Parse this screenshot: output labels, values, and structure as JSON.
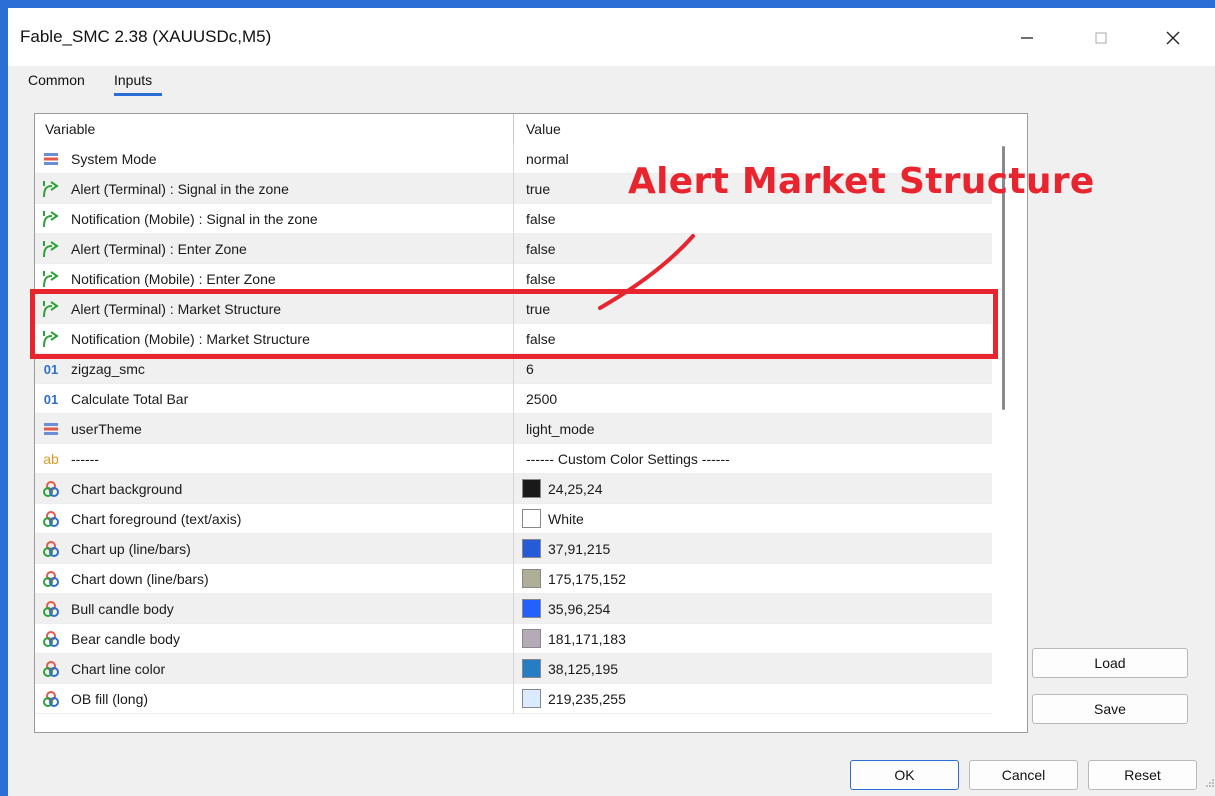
{
  "window": {
    "title": "Fable_SMC 2.38 (XAUUSDc,M5)",
    "accent_color": "#2b6fd6",
    "controls": [
      "minimize-icon",
      "maximize-icon",
      "close-icon"
    ]
  },
  "tabs": [
    {
      "label": "Common",
      "active": false
    },
    {
      "label": "Inputs",
      "active": true
    }
  ],
  "table": {
    "headers": {
      "variable": "Variable",
      "value": "Value"
    },
    "rows": [
      {
        "icon": "enum-icon",
        "variable": "System Mode",
        "value": "normal"
      },
      {
        "icon": "bool-icon",
        "variable": "Alert (Terminal) : Signal in the zone",
        "value": "true"
      },
      {
        "icon": "bool-icon",
        "variable": "Notification (Mobile) : Signal in the zone",
        "value": "false"
      },
      {
        "icon": "bool-icon",
        "variable": "Alert (Terminal) : Enter Zone",
        "value": "false"
      },
      {
        "icon": "bool-icon",
        "variable": "Notification (Mobile) : Enter Zone",
        "value": "false"
      },
      {
        "icon": "bool-icon",
        "variable": "Alert (Terminal) : Market Structure",
        "value": "true"
      },
      {
        "icon": "bool-icon",
        "variable": "Notification (Mobile) : Market Structure",
        "value": "false"
      },
      {
        "icon": "int-icon",
        "variable": "zigzag_smc",
        "value": "6"
      },
      {
        "icon": "int-icon",
        "variable": "Calculate Total Bar",
        "value": "2500"
      },
      {
        "icon": "enum-icon",
        "variable": "userTheme",
        "value": "light_mode"
      },
      {
        "icon": "string-icon",
        "variable": "------",
        "value": "------ Custom Color Settings ------"
      },
      {
        "icon": "color-icon",
        "variable": "Chart background",
        "value": "24,25,24",
        "swatch": "#181918"
      },
      {
        "icon": "color-icon",
        "variable": "Chart foreground (text/axis)",
        "value": "White",
        "swatch": "#ffffff"
      },
      {
        "icon": "color-icon",
        "variable": "Chart up (line/bars)",
        "value": "37,91,215",
        "swatch": "#255bd7"
      },
      {
        "icon": "color-icon",
        "variable": "Chart down (line/bars)",
        "value": "175,175,152",
        "swatch": "#afaf98"
      },
      {
        "icon": "color-icon",
        "variable": "Bull candle body",
        "value": "35,96,254",
        "swatch": "#2360fe"
      },
      {
        "icon": "color-icon",
        "variable": "Bear candle body",
        "value": "181,171,183",
        "swatch": "#b5abb7"
      },
      {
        "icon": "color-icon",
        "variable": "Chart line color",
        "value": "38,125,195",
        "swatch": "#267dc3"
      },
      {
        "icon": "color-icon",
        "variable": "OB fill (long)",
        "value": "219,235,255",
        "swatch": "#dbebff"
      }
    ]
  },
  "buttons": {
    "load": "Load",
    "save": "Save",
    "ok": "OK",
    "cancel": "Cancel",
    "reset": "Reset"
  },
  "annotation": {
    "text": "Alert Market Structure",
    "color": "#e8242f"
  }
}
